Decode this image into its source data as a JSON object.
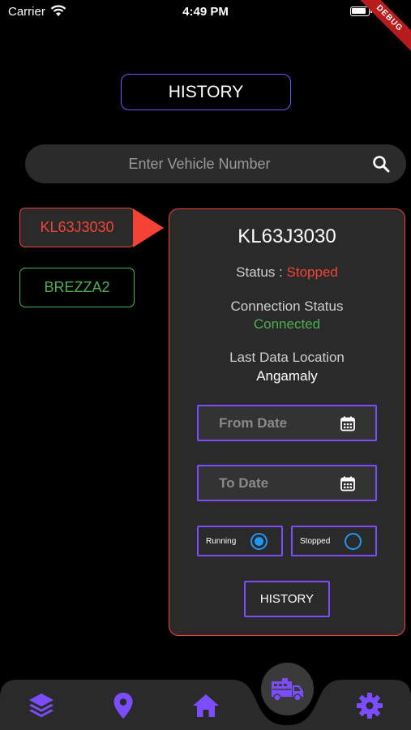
{
  "status_bar": {
    "carrier": "Carrier",
    "time": "4:49 PM"
  },
  "debug_badge": "DEBUG",
  "header": {
    "history_label": "HISTORY"
  },
  "search": {
    "placeholder": "Enter Vehicle Number",
    "icon": "search-icon"
  },
  "vehicles": [
    {
      "number": "KL63J3030",
      "state": "selected",
      "color": "#f44336"
    },
    {
      "number": "BREZZA2",
      "state": "available",
      "color": "#4caf50"
    }
  ],
  "details": {
    "vehicle_number": "KL63J3030",
    "status_label": "Status : ",
    "status_value": "Stopped",
    "connection_label": "Connection Status",
    "connection_value": "Connected",
    "location_label": "Last Data Location",
    "location_value": "Angamaly",
    "from_date_placeholder": "From Date",
    "to_date_placeholder": "To Date",
    "filters": [
      {
        "label": "Running",
        "selected": true
      },
      {
        "label": "Stopped",
        "selected": false
      }
    ],
    "history_button": "HISTORY"
  },
  "bottom_nav": {
    "items": [
      "layers-icon",
      "location-pin-icon",
      "home-icon",
      "truck-icon",
      "settings-icon"
    ],
    "active": "truck-icon"
  },
  "colors": {
    "accent": "#7c4dff",
    "danger": "#f44336",
    "success": "#4caf50",
    "radio": "#2196f3"
  }
}
